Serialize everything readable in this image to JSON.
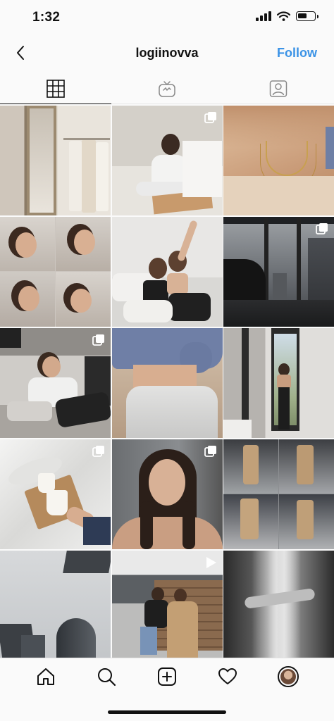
{
  "status_bar": {
    "time": "1:32",
    "battery_level": 0.55
  },
  "header": {
    "username": "logiinovva",
    "follow_label": "Follow"
  },
  "colors": {
    "follow": "#3b93e6",
    "text": "#111111"
  },
  "tabs": [
    {
      "name": "grid",
      "icon": "grid-icon",
      "active": true
    },
    {
      "name": "igtv",
      "icon": "tv-icon",
      "active": false
    },
    {
      "name": "tagged",
      "icon": "person-tag-icon",
      "active": false
    }
  ],
  "posts": [
    {
      "subject": "mirror and clothing rack",
      "badge": "none"
    },
    {
      "subject": "woman sitting on floor with magazines",
      "badge": "multiple"
    },
    {
      "subject": "close-up of necklaces",
      "badge": "none"
    },
    {
      "subject": "four selfie collage",
      "badge": "none"
    },
    {
      "subject": "two women on bed",
      "badge": "none"
    },
    {
      "subject": "city view through window with piano",
      "badge": "multiple"
    },
    {
      "subject": "woman lying on couch",
      "badge": "multiple"
    },
    {
      "subject": "torso in hoodie and sweatpants",
      "badge": "none"
    },
    {
      "subject": "woman at window",
      "badge": "none"
    },
    {
      "subject": "coffee cups on bed",
      "badge": "multiple"
    },
    {
      "subject": "portrait with wet hair",
      "badge": "multiple"
    },
    {
      "subject": "trench coat collage",
      "badge": "none"
    },
    {
      "subject": "skyscrapers from below",
      "badge": "none"
    },
    {
      "subject": "two women on bench",
      "badge": "video"
    },
    {
      "subject": "black and white abstract",
      "badge": "none"
    }
  ],
  "bottom_nav": [
    {
      "name": "home",
      "icon": "home-icon"
    },
    {
      "name": "search",
      "icon": "search-icon"
    },
    {
      "name": "new-post",
      "icon": "plus-square-icon"
    },
    {
      "name": "activity",
      "icon": "heart-icon"
    },
    {
      "name": "profile",
      "icon": "avatar"
    }
  ]
}
